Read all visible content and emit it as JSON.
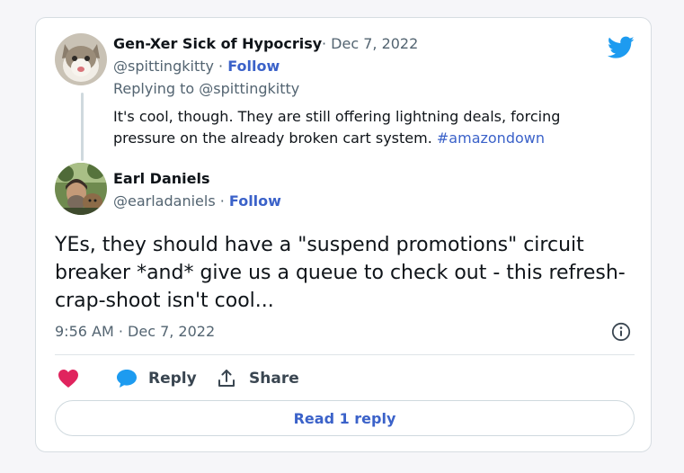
{
  "reply_tweet": {
    "author_name": "Gen-Xer Sick of Hypocrisy",
    "date": "· Dec 7, 2022",
    "handle": "@spittingkitty",
    "separator": " · ",
    "follow_label": "Follow",
    "replying_to_prefix": "Replying to ",
    "replying_to_handle": "@spittingkitty",
    "text": "It's cool, though. They are still offering lightning deals, forcing pressure on the already broken cart system. ",
    "hashtag": "#amazondown"
  },
  "main_tweet": {
    "author_name": "Earl Daniels",
    "handle": "@earladaniels",
    "separator": " · ",
    "follow_label": "Follow",
    "text": "YEs, they should have a \"suspend promotions\" circuit breaker *and* give us a queue to check out - this refresh-crap-shoot isn't cool...",
    "timestamp": "9:56 AM · Dec 7, 2022"
  },
  "actions": {
    "like_icon": "heart-icon",
    "reply_label": "Reply",
    "share_label": "Share"
  },
  "read_replies_label": "Read 1 reply",
  "colors": {
    "accent": "#3b62c9",
    "heart": "#e0245e",
    "bird": "#1d9bf0"
  }
}
